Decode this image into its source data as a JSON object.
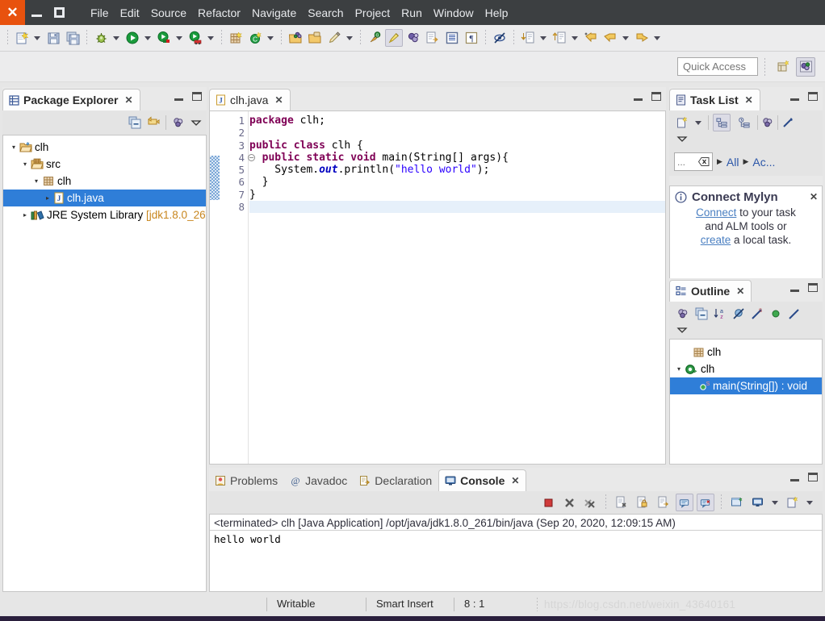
{
  "window": {
    "close_label": "✕",
    "minimize_label": "minimize",
    "maximize_label": "maximize"
  },
  "menubar": {
    "items": [
      {
        "label": "File"
      },
      {
        "label": "Edit"
      },
      {
        "label": "Source"
      },
      {
        "label": "Refactor"
      },
      {
        "label": "Navigate"
      },
      {
        "label": "Search"
      },
      {
        "label": "Project"
      },
      {
        "label": "Run"
      },
      {
        "label": "Window"
      },
      {
        "label": "Help"
      }
    ]
  },
  "toolbar": {
    "groups": [
      {
        "icons": [
          "new-file-icon",
          "dropdown-arrow",
          "save-icon",
          "save-all-icon"
        ]
      },
      {
        "icons": [
          "debug-icon",
          "dropdown-arrow",
          "run-icon",
          "dropdown-arrow",
          "run-external-tools-icon",
          "dropdown-arrow",
          "coverage-icon",
          "dropdown-arrow"
        ]
      },
      {
        "icons": [
          "new-java-project-icon",
          "new-java-class-icon",
          "dropdown-arrow"
        ]
      },
      {
        "icons": [
          "open-type-icon",
          "open-task-icon",
          "pencil-icon",
          "dropdown-arrow"
        ]
      },
      {
        "icons": [
          "search-icon",
          "mark-occurrences-icon",
          "link-icon",
          "export-icon",
          "outline-icon",
          "pilcrow-icon"
        ]
      },
      {
        "icons": [
          "hide-icon"
        ]
      },
      {
        "icons": [
          "next-annotation-icon",
          "dropdown-arrow",
          "previous-annotation-icon",
          "dropdown-arrow",
          "last-edit-icon",
          "back-icon",
          "dropdown-arrow",
          "forward-icon",
          "dropdown-arrow"
        ]
      }
    ]
  },
  "quick_access": {
    "placeholder": "Quick Access",
    "value": "",
    "perspective_new_label": "open-perspective",
    "perspective_java_label": "java-perspective"
  },
  "package_explorer": {
    "title": "Package Explorer",
    "close_label": "✕",
    "toolbar_icons": [
      "collapse-all-icon",
      "link-with-editor-icon",
      "view-menu-icon",
      "chevron-down-icon"
    ],
    "tree": [
      {
        "indent": 0,
        "twisty": "▾",
        "icon": "project-icon",
        "label": "clh",
        "selected": false
      },
      {
        "indent": 1,
        "twisty": "▾",
        "icon": "source-folder-icon",
        "label": "src",
        "selected": false
      },
      {
        "indent": 2,
        "twisty": "▾",
        "icon": "package-icon",
        "label": "clh",
        "selected": false
      },
      {
        "indent": 3,
        "twisty": "▸",
        "icon": "java-file-icon",
        "label": "clh.java",
        "selected": true
      },
      {
        "indent": 1,
        "twisty": "▸",
        "icon": "library-icon",
        "label": "JRE System Library ",
        "dim": "[jdk1.8.0_26",
        "selected": false
      }
    ]
  },
  "editor": {
    "tab_label": "clh.java",
    "tab_icon": "java-file-icon",
    "close_label": "✕",
    "lines": [
      {
        "num": "1",
        "fold": false,
        "current": false,
        "tokens": [
          {
            "t": "package",
            "c": "kw"
          },
          {
            "t": " clh;",
            "c": "pl"
          }
        ]
      },
      {
        "num": "2",
        "fold": false,
        "current": false,
        "tokens": [
          {
            "t": "",
            "c": "pl"
          }
        ]
      },
      {
        "num": "3",
        "fold": false,
        "current": false,
        "tokens": [
          {
            "t": "public class",
            "c": "kw"
          },
          {
            "t": " clh {",
            "c": "pl"
          }
        ]
      },
      {
        "num": "4",
        "fold": true,
        "current": false,
        "tokens": [
          {
            "t": "  ",
            "c": "pl"
          },
          {
            "t": "public static void",
            "c": "kw"
          },
          {
            "t": " main(String[] args){",
            "c": "pl"
          }
        ]
      },
      {
        "num": "5",
        "fold": false,
        "current": false,
        "tokens": [
          {
            "t": "    System.",
            "c": "pl"
          },
          {
            "t": "out",
            "c": "fld"
          },
          {
            "t": ".println(",
            "c": "pl"
          },
          {
            "t": "\"hello world\"",
            "c": "str"
          },
          {
            "t": ");",
            "c": "pl"
          }
        ]
      },
      {
        "num": "6",
        "fold": false,
        "current": false,
        "tokens": [
          {
            "t": "  }",
            "c": "pl"
          }
        ]
      },
      {
        "num": "7",
        "fold": false,
        "current": false,
        "tokens": [
          {
            "t": "}",
            "c": "pl"
          }
        ]
      },
      {
        "num": "8",
        "fold": false,
        "current": true,
        "tokens": [
          {
            "t": "",
            "c": "pl"
          }
        ]
      }
    ]
  },
  "task_list": {
    "title": "Task List",
    "close_label": "✕",
    "toolbar_icons": [
      "new-task-icon",
      "dropdown-arrow",
      "categorized-icon",
      "scheduled-icon",
      "synchronize-icon",
      "focus-icon",
      "chevron-down-icon"
    ],
    "filter_value": "...",
    "filter_clear_label": "clear-filter",
    "presentation_all": "All",
    "presentation_active": "Ac...",
    "notice": {
      "title": "Connect Mylyn",
      "close_label": "✕",
      "link1": "Connect",
      "text1": " to your task",
      "text2": "and ALM tools or",
      "link2": "create",
      "text3": " a local task."
    }
  },
  "outline": {
    "title": "Outline",
    "close_label": "✕",
    "toolbar_icons": [
      "focus-icon",
      "collapse-all-icon",
      "sort-icon",
      "hide-fields-icon",
      "hide-static-icon",
      "hide-nonpublic-icon",
      "hide-local-icon",
      "chevron-down-icon"
    ],
    "tree": [
      {
        "indent": 0,
        "twisty": "",
        "icon": "package-icon",
        "label": "clh",
        "selected": false
      },
      {
        "indent": 0,
        "twisty": "▾",
        "icon": "class-icon",
        "label": "clh",
        "selected": false
      },
      {
        "indent": 1,
        "twisty": "",
        "icon": "method-icon",
        "label": "main(String[]) : void",
        "selected": true
      }
    ]
  },
  "bottom_panel": {
    "tabs": [
      {
        "label": "Problems",
        "icon": "problems-icon",
        "active": false
      },
      {
        "label": "Javadoc",
        "icon": "javadoc-icon",
        "active": false
      },
      {
        "label": "Declaration",
        "icon": "declaration-icon",
        "active": false
      },
      {
        "label": "Console",
        "icon": "console-icon",
        "active": true
      }
    ],
    "close_label": "✕",
    "toolbar_icons": [
      "terminate-icon",
      "remove-launch-icon",
      "remove-all-launches-icon",
      "clear-console-icon",
      "lock-scroll-icon",
      "scroll-lock-icon",
      "show-console-on-output-icon",
      "show-console-on-error-icon",
      "pin-console-icon",
      "display-selected-console-icon",
      "dropdown-arrow",
      "open-console-icon",
      "dropdown-arrow"
    ],
    "console": {
      "header": "<terminated> clh [Java Application] /opt/java/jdk1.8.0_261/bin/java (Sep 20, 2020, 12:09:15 AM)",
      "output": "hello world"
    }
  },
  "statusbar": {
    "writable": "Writable",
    "insert_mode": "Smart Insert",
    "position": "8 : 1",
    "watermark": "https://blog.csdn.net/weixin_43640161"
  },
  "colors": {
    "titlebar_bg": "#3c3f41",
    "close_btn": "#e8520e",
    "selection": "#2f7ed8",
    "keyword": "#7f0055",
    "string": "#2a00ff",
    "field": "#0000c0",
    "link": "#4a7fc1"
  }
}
